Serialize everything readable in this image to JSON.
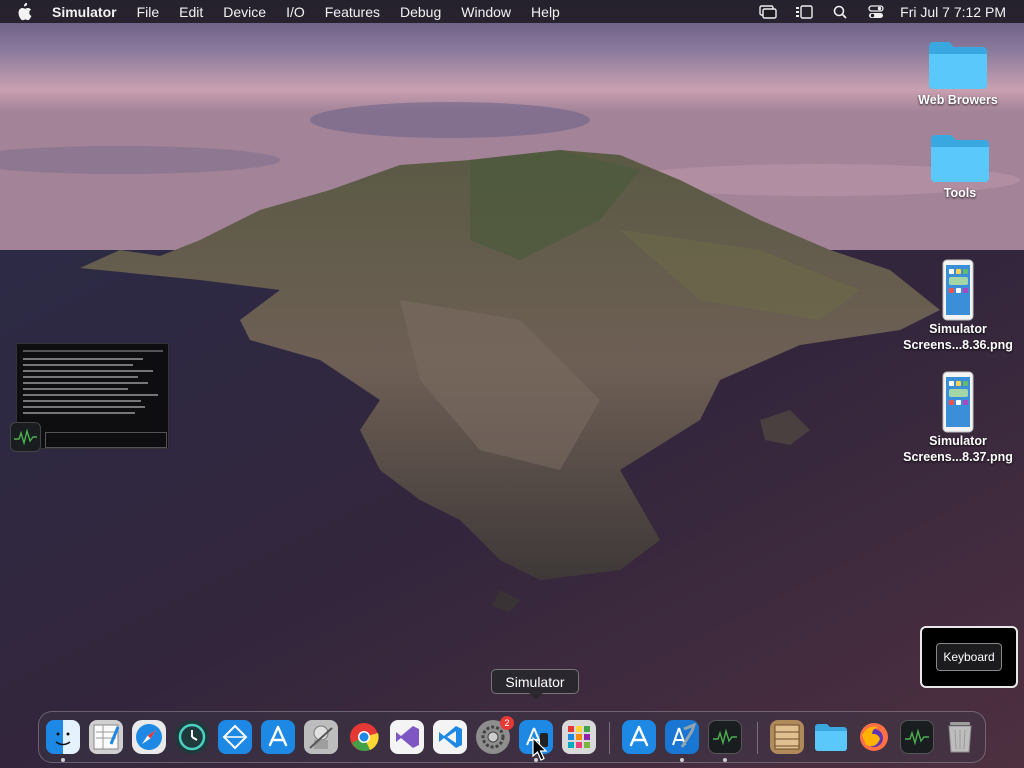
{
  "menubar": {
    "app_name": "Simulator",
    "items": [
      "File",
      "Edit",
      "Device",
      "I/O",
      "Features",
      "Debug",
      "Window",
      "Help"
    ],
    "clock": "Fri Jul 7  7:12 PM"
  },
  "desktop": {
    "icons": [
      {
        "label": "Web Browers",
        "type": "folder"
      },
      {
        "label": "Tools",
        "type": "folder"
      },
      {
        "label_line1": "Simulator",
        "label_line2": "Screens...8.36.png",
        "type": "screenshot"
      },
      {
        "label_line1": "Simulator",
        "label_line2": "Screens...8.37.png",
        "type": "screenshot"
      }
    ]
  },
  "keyboard_panel": {
    "button_label": "Keyboard"
  },
  "tooltip": {
    "text": "Simulator"
  },
  "dock": {
    "items": [
      {
        "name": "finder",
        "running": true
      },
      {
        "name": "script-editor",
        "running": false
      },
      {
        "name": "safari",
        "running": false
      },
      {
        "name": "time-machine",
        "running": false
      },
      {
        "name": "xcode-instruments",
        "running": false
      },
      {
        "name": "app-store-connect",
        "running": false
      },
      {
        "name": "automator",
        "running": false
      },
      {
        "name": "chrome",
        "running": false
      },
      {
        "name": "visual-studio",
        "running": false
      },
      {
        "name": "vscode",
        "running": false
      },
      {
        "name": "system-preferences",
        "running": false,
        "badge": "2"
      },
      {
        "name": "simulator",
        "running": true
      },
      {
        "name": "launchpad",
        "running": false
      },
      {
        "name": "app-store",
        "running": false
      },
      {
        "name": "xcode",
        "running": true
      },
      {
        "name": "activity-monitor",
        "running": true
      },
      {
        "name": "archive-utility",
        "running": false
      },
      {
        "name": "downloads-folder",
        "running": false
      },
      {
        "name": "firefox",
        "running": false
      },
      {
        "name": "activity-monitor-2",
        "running": false
      },
      {
        "name": "trash",
        "running": false
      }
    ]
  },
  "colors": {
    "accent_blue": "#1e88e5",
    "folder_blue": "#5ac8fa",
    "badge_red": "#e53935"
  }
}
